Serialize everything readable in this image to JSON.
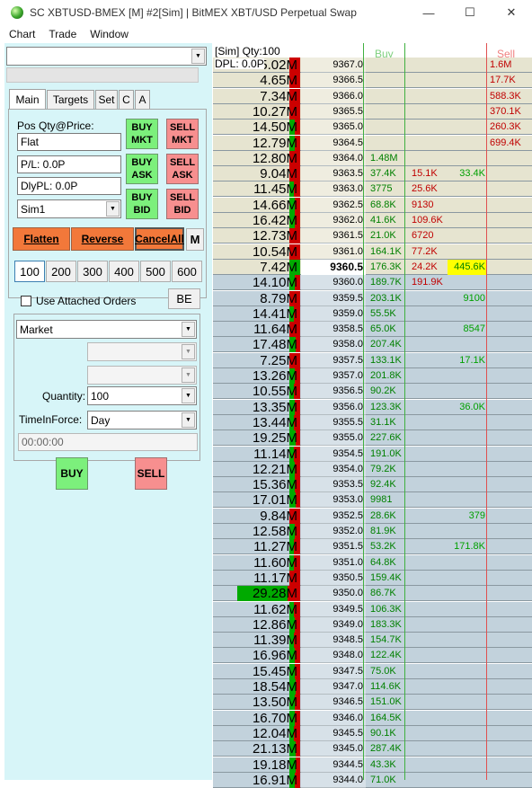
{
  "window": {
    "title": "SC XBTUSD-BMEX [M]  #2[Sim]  | BitMEX XBT/USD Perpetual Swap",
    "minimize": "—",
    "maximize": "☐",
    "close": "✕"
  },
  "menu": [
    "Chart",
    "Trade",
    "Window"
  ],
  "panel": {
    "tabs": [
      "Main",
      "Targets",
      "Set",
      "C",
      "A"
    ],
    "pos_label": "Pos Qty@Price:",
    "pos_value": "Flat",
    "pl_value": "P/L: 0.0P",
    "dlypl_value": "DlyPL: 0.0P",
    "account": "Sim1",
    "buy_mkt": "BUY MKT",
    "sell_mkt": "SELL MKT",
    "buy_ask": "BUY ASK",
    "sell_ask": "SELL ASK",
    "buy_bid": "BUY BID",
    "sell_bid": "SELL BID",
    "flatten": "Flatten",
    "reverse": "Reverse",
    "cancel_all": "CancelAll",
    "m_button": "M",
    "qty_buttons": [
      "100",
      "200",
      "300",
      "400",
      "500",
      "600"
    ],
    "use_attached": "Use Attached Orders",
    "be_button": "BE",
    "order_type": "Market",
    "quantity_label": "Quantity:",
    "quantity_value": "100",
    "tif_label": "TimeInForce:",
    "tif_value": "Day",
    "time_value": "00:00:00",
    "buy": "BUY",
    "sell": "SELL"
  },
  "ladder": {
    "header_line1": "[Sim]  Qty:100",
    "header_line2": "DPL: 0.0P",
    "buy_header": "Buy",
    "sell_header": "Sell",
    "colors": {
      "ask_bg": "#e6e4d0",
      "bid_bg": "#c2d2dc",
      "green": "#00aa00",
      "red": "#cc0000",
      "highlight": "#ffff00"
    },
    "rows": [
      {
        "vol": "5.02M",
        "g": 0.0,
        "r": 1.0,
        "price": "9367.0",
        "bid": "",
        "sell": "",
        "buy": "",
        "ask": "1.6M",
        "side": "ask"
      },
      {
        "vol": "4.65M",
        "g": 0.0,
        "r": 1.0,
        "price": "9366.5",
        "bid": "",
        "sell": "",
        "buy": "",
        "ask": "17.7K",
        "side": "ask"
      },
      {
        "vol": "7.34M",
        "g": 0.0,
        "r": 1.0,
        "price": "9366.0",
        "bid": "",
        "sell": "",
        "buy": "",
        "ask": "588.3K",
        "side": "ask"
      },
      {
        "vol": "10.27M",
        "g": 0.0,
        "r": 1.0,
        "price": "9365.5",
        "bid": "",
        "sell": "",
        "buy": "",
        "ask": "370.1K",
        "side": "ask"
      },
      {
        "vol": "14.50M",
        "g": 0.5,
        "r": 0.5,
        "price": "9365.0",
        "bid": "",
        "sell": "",
        "buy": "",
        "ask": "260.3K",
        "side": "ask"
      },
      {
        "vol": "12.79M",
        "g": 0.5,
        "r": 0.5,
        "price": "9364.5",
        "bid": "",
        "sell": "",
        "buy": "",
        "ask": "699.4K",
        "side": "ask"
      },
      {
        "vol": "12.80M",
        "g": 0.0,
        "r": 1.0,
        "price": "9364.0",
        "bid": "1.48M",
        "sell": "",
        "buy": "",
        "ask": "",
        "side": "ask"
      },
      {
        "vol": "9.04M",
        "g": 0.0,
        "r": 1.0,
        "price": "9363.5",
        "bid": "37.4K",
        "sell": "15.1K",
        "buy": "33.4K",
        "ask": "",
        "side": "ask"
      },
      {
        "vol": "11.45M",
        "g": 0.4,
        "r": 0.6,
        "price": "9363.0",
        "bid": "3775",
        "sell": "25.6K",
        "buy": "",
        "ask": "",
        "side": "ask"
      },
      {
        "vol": "14.66M",
        "g": 0.5,
        "r": 0.5,
        "price": "9362.5",
        "bid": "68.8K",
        "sell": "9130",
        "buy": "",
        "ask": "",
        "side": "ask"
      },
      {
        "vol": "16.42M",
        "g": 0.5,
        "r": 0.5,
        "price": "9362.0",
        "bid": "41.6K",
        "sell": "109.6K",
        "buy": "",
        "ask": "",
        "side": "ask"
      },
      {
        "vol": "12.73M",
        "g": 0.0,
        "r": 1.0,
        "price": "9361.5",
        "bid": "21.0K",
        "sell": "6720",
        "buy": "",
        "ask": "",
        "side": "ask"
      },
      {
        "vol": "10.54M",
        "g": 0.0,
        "r": 1.0,
        "price": "9361.0",
        "bid": "164.1K",
        "sell": "77.2K",
        "buy": "",
        "ask": "",
        "side": "ask"
      },
      {
        "vol": "7.42M",
        "g": 1.0,
        "r": 0.0,
        "price": "9360.5",
        "bid": "176.3K",
        "sell": "24.2K",
        "buy": "445.6K",
        "ask": "",
        "side": "ask",
        "last": true
      },
      {
        "vol": "14.10M",
        "g": 0.5,
        "r": 0.5,
        "price": "9360.0",
        "bid": "189.7K",
        "sell": "191.9K",
        "buy": "",
        "ask": "",
        "side": "bid"
      },
      {
        "vol": "8.79M",
        "g": 0.0,
        "r": 1.0,
        "price": "9359.5",
        "bid": "203.1K",
        "sell": "",
        "buy": "9100",
        "ask": "",
        "side": "bid"
      },
      {
        "vol": "14.41M",
        "g": 0.4,
        "r": 0.6,
        "price": "9359.0",
        "bid": "55.5K",
        "sell": "",
        "buy": "",
        "ask": "",
        "side": "bid"
      },
      {
        "vol": "11.64M",
        "g": 0.0,
        "r": 1.0,
        "price": "9358.5",
        "bid": "65.0K",
        "sell": "",
        "buy": "8547",
        "ask": "",
        "side": "bid"
      },
      {
        "vol": "17.48M",
        "g": 0.6,
        "r": 0.4,
        "price": "9358.0",
        "bid": "207.4K",
        "sell": "",
        "buy": "",
        "ask": "",
        "side": "bid"
      },
      {
        "vol": "7.25M",
        "g": 0.0,
        "r": 1.0,
        "price": "9357.5",
        "bid": "133.1K",
        "sell": "",
        "buy": "17.1K",
        "ask": "",
        "side": "bid"
      },
      {
        "vol": "13.26M",
        "g": 0.5,
        "r": 0.5,
        "price": "9357.0",
        "bid": "201.8K",
        "sell": "",
        "buy": "",
        "ask": "",
        "side": "bid"
      },
      {
        "vol": "10.55M",
        "g": 0.4,
        "r": 0.6,
        "price": "9356.5",
        "bid": "90.2K",
        "sell": "",
        "buy": "",
        "ask": "",
        "side": "bid"
      },
      {
        "vol": "13.35M",
        "g": 0.5,
        "r": 0.5,
        "price": "9356.0",
        "bid": "123.3K",
        "sell": "",
        "buy": "36.0K",
        "ask": "",
        "side": "bid"
      },
      {
        "vol": "13.44M",
        "g": 0.4,
        "r": 0.6,
        "price": "9355.5",
        "bid": "31.1K",
        "sell": "",
        "buy": "",
        "ask": "",
        "side": "bid"
      },
      {
        "vol": "19.25M",
        "g": 0.6,
        "r": 0.4,
        "price": "9355.0",
        "bid": "227.6K",
        "sell": "",
        "buy": "",
        "ask": "",
        "side": "bid"
      },
      {
        "vol": "11.14M",
        "g": 0.4,
        "r": 0.6,
        "price": "9354.5",
        "bid": "191.0K",
        "sell": "",
        "buy": "",
        "ask": "",
        "side": "bid"
      },
      {
        "vol": "12.21M",
        "g": 0.5,
        "r": 0.5,
        "price": "9354.0",
        "bid": "79.2K",
        "sell": "",
        "buy": "",
        "ask": "",
        "side": "bid"
      },
      {
        "vol": "15.36M",
        "g": 0.5,
        "r": 0.5,
        "price": "9353.5",
        "bid": "92.4K",
        "sell": "",
        "buy": "",
        "ask": "",
        "side": "bid"
      },
      {
        "vol": "17.01M",
        "g": 0.6,
        "r": 0.4,
        "price": "9353.0",
        "bid": "9981",
        "sell": "",
        "buy": "",
        "ask": "",
        "side": "bid"
      },
      {
        "vol": "9.84M",
        "g": 0.0,
        "r": 1.0,
        "price": "9352.5",
        "bid": "28.6K",
        "sell": "",
        "buy": "379",
        "ask": "",
        "side": "bid"
      },
      {
        "vol": "12.58M",
        "g": 0.5,
        "r": 0.5,
        "price": "9352.0",
        "bid": "81.9K",
        "sell": "",
        "buy": "",
        "ask": "",
        "side": "bid"
      },
      {
        "vol": "11.27M",
        "g": 0.4,
        "r": 0.6,
        "price": "9351.5",
        "bid": "53.2K",
        "sell": "",
        "buy": "171.8K",
        "ask": "",
        "side": "bid"
      },
      {
        "vol": "11.60M",
        "g": 0.4,
        "r": 0.6,
        "price": "9351.0",
        "bid": "64.8K",
        "sell": "",
        "buy": "",
        "ask": "",
        "side": "bid"
      },
      {
        "vol": "11.17M",
        "g": 0.0,
        "r": 1.0,
        "price": "9350.5",
        "bid": "159.4K",
        "sell": "",
        "buy": "",
        "ask": "",
        "side": "bid"
      },
      {
        "vol": "29.28M",
        "g": 0.8,
        "r": 0.2,
        "price": "9350.0",
        "bid": "86.7K",
        "sell": "",
        "buy": "",
        "ask": "",
        "side": "bid",
        "wide": true
      },
      {
        "vol": "11.62M",
        "g": 0.4,
        "r": 0.6,
        "price": "9349.5",
        "bid": "106.3K",
        "sell": "",
        "buy": "",
        "ask": "",
        "side": "bid"
      },
      {
        "vol": "12.86M",
        "g": 0.5,
        "r": 0.5,
        "price": "9349.0",
        "bid": "183.3K",
        "sell": "",
        "buy": "",
        "ask": "",
        "side": "bid"
      },
      {
        "vol": "11.39M",
        "g": 0.4,
        "r": 0.6,
        "price": "9348.5",
        "bid": "154.7K",
        "sell": "",
        "buy": "",
        "ask": "",
        "side": "bid"
      },
      {
        "vol": "16.96M",
        "g": 0.5,
        "r": 0.5,
        "price": "9348.0",
        "bid": "122.4K",
        "sell": "",
        "buy": "",
        "ask": "",
        "side": "bid"
      },
      {
        "vol": "15.45M",
        "g": 0.5,
        "r": 0.5,
        "price": "9347.5",
        "bid": "75.0K",
        "sell": "",
        "buy": "",
        "ask": "",
        "side": "bid"
      },
      {
        "vol": "18.54M",
        "g": 0.6,
        "r": 0.4,
        "price": "9347.0",
        "bid": "114.6K",
        "sell": "",
        "buy": "",
        "ask": "",
        "side": "bid"
      },
      {
        "vol": "13.50M",
        "g": 0.5,
        "r": 0.5,
        "price": "9346.5",
        "bid": "151.0K",
        "sell": "",
        "buy": "",
        "ask": "",
        "side": "bid"
      },
      {
        "vol": "16.70M",
        "g": 0.5,
        "r": 0.5,
        "price": "9346.0",
        "bid": "164.5K",
        "sell": "",
        "buy": "",
        "ask": "",
        "side": "bid"
      },
      {
        "vol": "12.04M",
        "g": 0.4,
        "r": 0.6,
        "price": "9345.5",
        "bid": "90.1K",
        "sell": "",
        "buy": "",
        "ask": "",
        "side": "bid"
      },
      {
        "vol": "21.13M",
        "g": 0.6,
        "r": 0.4,
        "price": "9345.0",
        "bid": "287.4K",
        "sell": "",
        "buy": "",
        "ask": "",
        "side": "bid"
      },
      {
        "vol": "19.18M",
        "g": 0.6,
        "r": 0.4,
        "price": "9344.5",
        "bid": "43.3K",
        "sell": "",
        "buy": "",
        "ask": "",
        "side": "bid"
      },
      {
        "vol": "16.91M",
        "g": 0.5,
        "r": 0.5,
        "price": "9344.0",
        "bid": "71.0K",
        "sell": "",
        "buy": "",
        "ask": "",
        "side": "bid"
      }
    ]
  }
}
